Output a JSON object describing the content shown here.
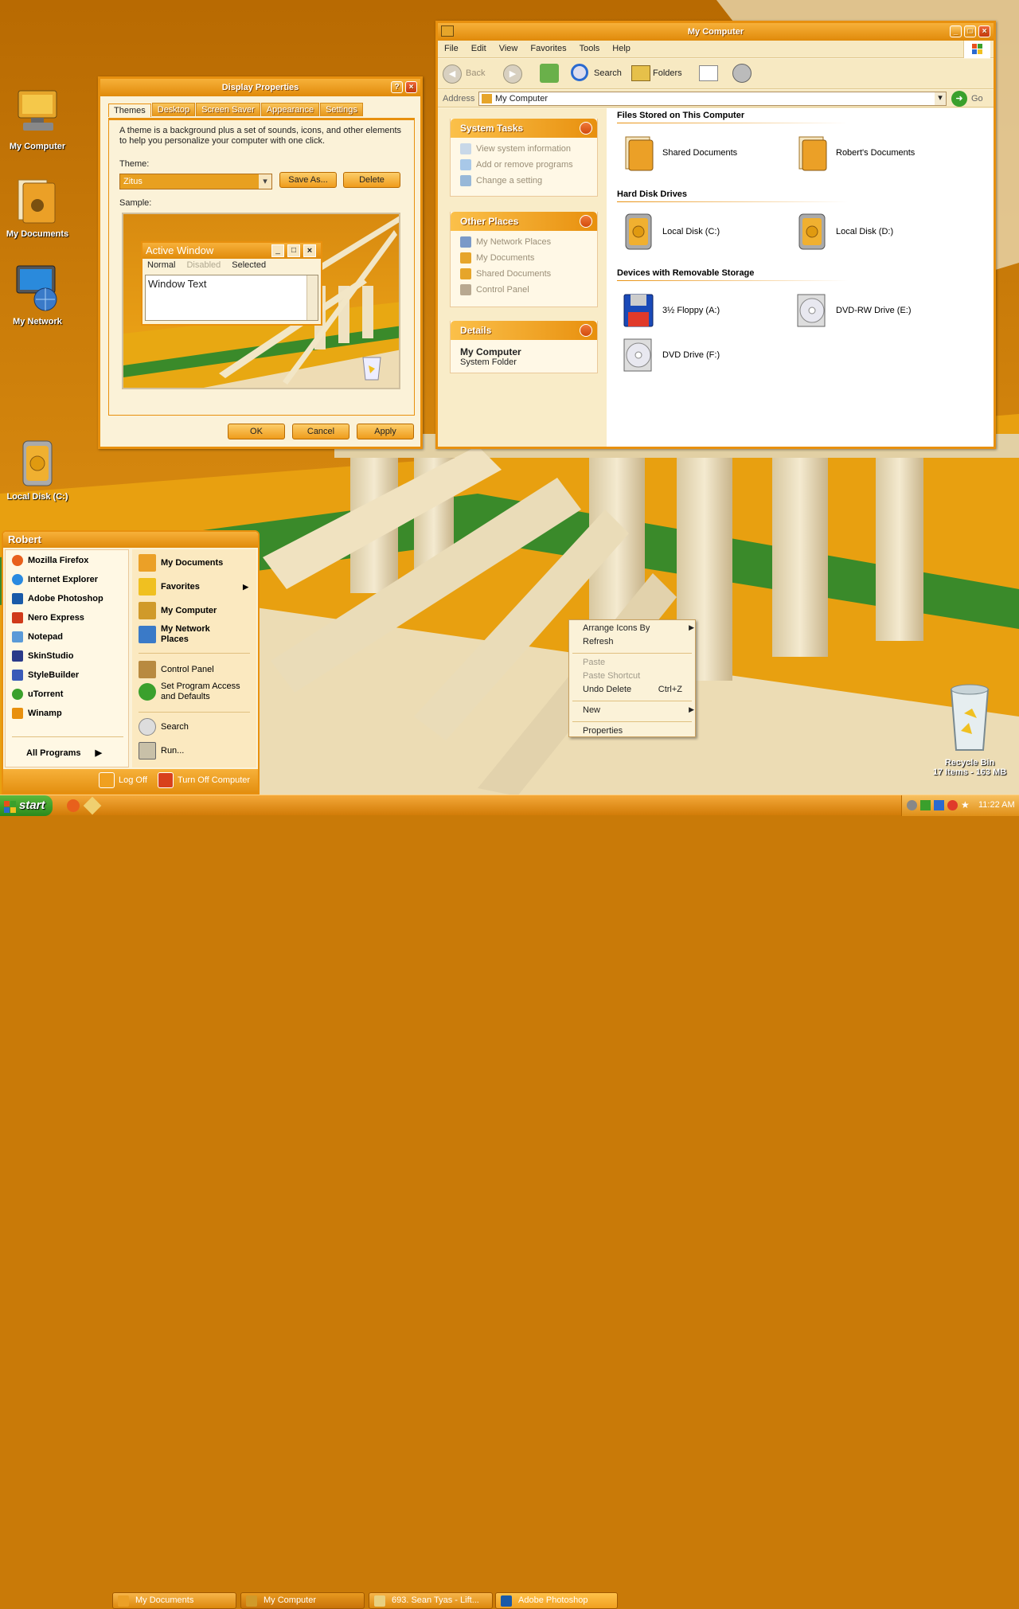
{
  "colors": {
    "accent": "#e8900e",
    "panel_bg": "#fbf2d8",
    "desktop_bg": "#c97a08"
  },
  "desktop": {
    "icons": [
      {
        "label": "My Computer",
        "icon": "computer-icon"
      },
      {
        "label": "My Documents",
        "icon": "folder-icon"
      },
      {
        "label": "My Network",
        "icon": "network-icon"
      },
      {
        "label": "Local Disk (C:)",
        "icon": "disk-icon"
      },
      {
        "label": "Recycle Bin",
        "icon": "recycle-bin-icon"
      }
    ],
    "recycle_info": "17 Items - 163 MB"
  },
  "display_properties": {
    "title": "Display Properties",
    "tabs": [
      "Themes",
      "Desktop",
      "Screen Saver",
      "Appearance",
      "Settings"
    ],
    "description": "A theme is a background plus a set of sounds, icons, and other elements to help you personalize your computer with one click.",
    "theme_label": "Theme:",
    "theme_value": "Zitus",
    "save_as": "Save As...",
    "delete": "Delete",
    "sample_label": "Sample:",
    "sample": {
      "title": "Active Window",
      "menu": [
        "Normal",
        "Disabled",
        "Selected"
      ],
      "text": "Window Text"
    },
    "ok": "OK",
    "cancel": "Cancel",
    "apply": "Apply"
  },
  "explorer": {
    "title": "My Computer",
    "menu": [
      "File",
      "Edit",
      "View",
      "Favorites",
      "Tools",
      "Help"
    ],
    "toolbar": {
      "back": "Back",
      "search": "Search",
      "folders": "Folders"
    },
    "address_label": "Address",
    "address_value": "My Computer",
    "go": "Go",
    "system_tasks": {
      "title": "System Tasks",
      "items": [
        "View system information",
        "Add or remove programs",
        "Change a setting"
      ]
    },
    "other_places": {
      "title": "Other Places",
      "items": [
        "My Network Places",
        "My Documents",
        "Shared Documents",
        "Control Panel"
      ]
    },
    "details": {
      "title": "Details",
      "name": "My Computer",
      "type": "System Folder"
    },
    "sections": [
      {
        "title": "Files Stored on This Computer",
        "items": [
          "Shared Documents",
          "Robert's Documents"
        ]
      },
      {
        "title": "Hard Disk Drives",
        "items": [
          "Local Disk (C:)",
          "Local Disk (D:)"
        ]
      },
      {
        "title": "Devices with Removable Storage",
        "items": [
          "3½ Floppy (A:)",
          "DVD-RW Drive (E:)",
          "DVD Drive (F:)"
        ]
      }
    ]
  },
  "start_menu": {
    "user": "Robert",
    "left": [
      "Mozilla Firefox",
      "Internet Explorer",
      "Adobe Photoshop",
      "Nero Express",
      "Notepad",
      "SkinStudio",
      "StyleBuilder",
      "uTorrent",
      "Winamp"
    ],
    "all_programs": "All Programs",
    "right": {
      "my_documents": "My Documents",
      "favorites": "Favorites",
      "my_computer": "My Computer",
      "my_network": "My Network Places",
      "control_panel": "Control Panel",
      "set_program": "Set Program Access and Defaults",
      "search": "Search",
      "run": "Run..."
    },
    "log_off": "Log Off",
    "turn_off": "Turn Off Computer"
  },
  "context_menu": {
    "arrange": "Arrange Icons By",
    "refresh": "Refresh",
    "paste": "Paste",
    "paste_shortcut": "Paste Shortcut",
    "undo": "Undo Delete",
    "undo_key": "Ctrl+Z",
    "new": "New",
    "properties": "Properties"
  },
  "taskbar": {
    "start": "start",
    "tasks": [
      "My Documents",
      "My Computer",
      "693. Sean Tyas - Lift...",
      "Adobe Photoshop"
    ],
    "clock": "11:22 AM"
  }
}
